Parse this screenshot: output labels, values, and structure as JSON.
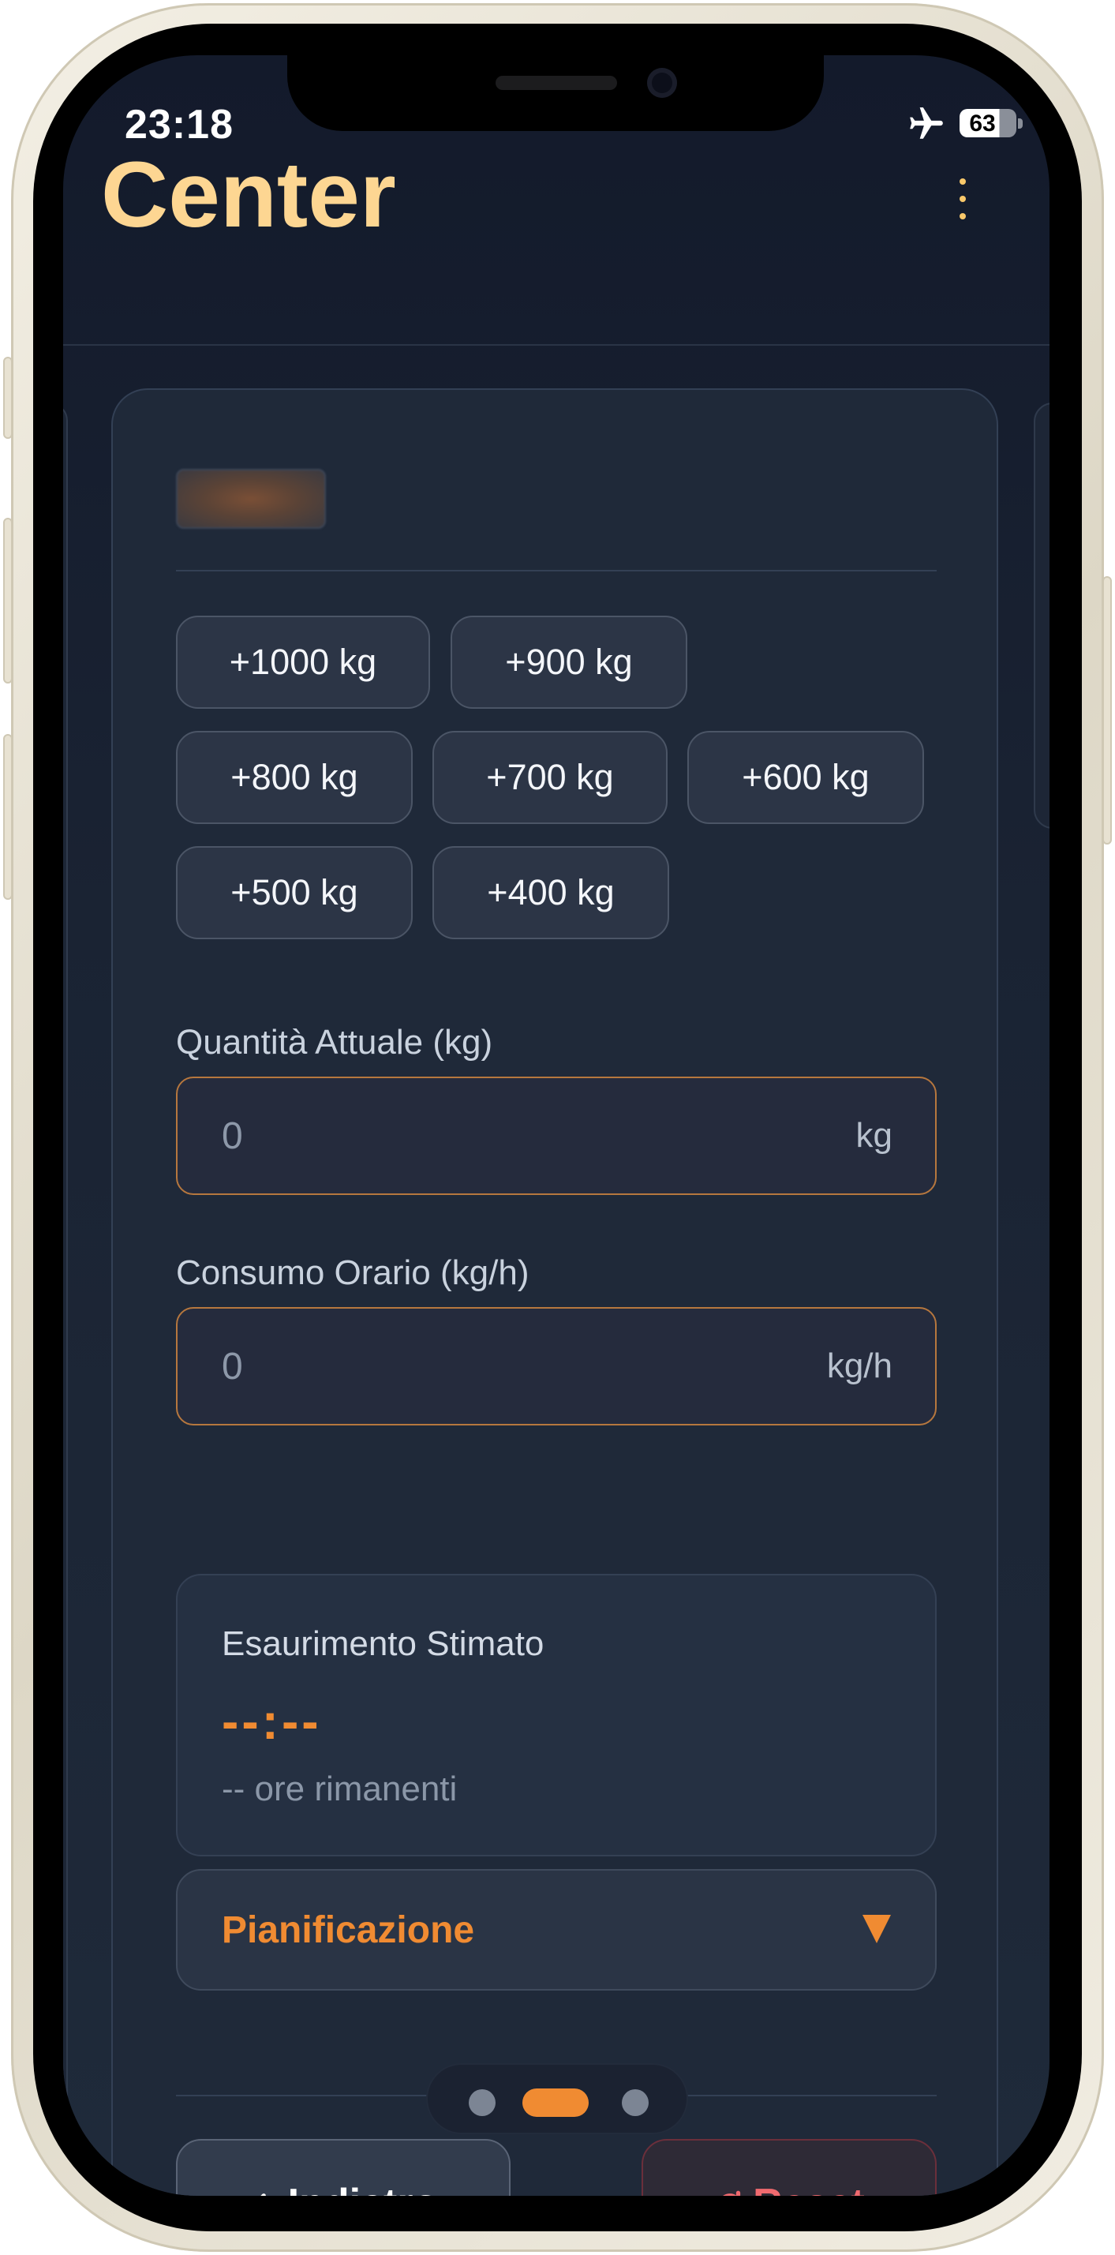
{
  "status_bar": {
    "time": "23:18",
    "battery": "63",
    "airplane_icon": "airplane-icon"
  },
  "header": {
    "title": "Center",
    "menu_icon": "more-vertical-icon"
  },
  "quick_add": {
    "buttons": [
      "+1000 kg",
      "+900 kg",
      "+800 kg",
      "+700 kg",
      "+600 kg",
      "+500 kg",
      "+400 kg"
    ]
  },
  "current_quantity": {
    "label": "Quantità Attuale (kg)",
    "value": "0",
    "unit": "kg"
  },
  "hourly_consumption": {
    "label": "Consumo Orario (kg/h)",
    "value": "0",
    "unit": "kg/h"
  },
  "estimate": {
    "title": "Esaurimento Stimato",
    "time": "--:--",
    "remaining": "-- ore rimanenti"
  },
  "planning": {
    "label": "Pianificazione",
    "icon": "triangle-down-icon"
  },
  "actions": {
    "back_label": "Indietro",
    "back_icon": "arrow-left-icon",
    "reset_label": "Reset",
    "reset_icon": "refresh-icon"
  },
  "page_indicator": {
    "count": 3,
    "active_index": 1
  },
  "colors": {
    "accent": "#f08b32",
    "title": "#fdd692",
    "danger": "#f06a6f",
    "background": "#1a2333"
  }
}
